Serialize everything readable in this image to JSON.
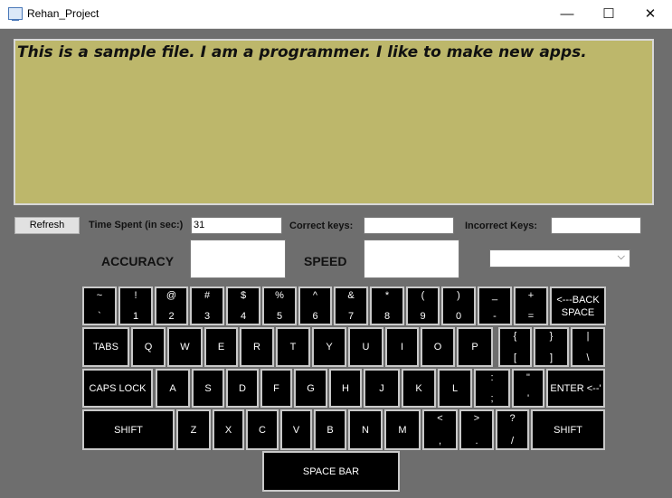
{
  "window": {
    "title": "Rehan_Project",
    "minimize": "—",
    "maximize": "☐",
    "close": "✕"
  },
  "editor": {
    "text": "This is a sample file. I am a programmer. I like to make new apps."
  },
  "stats": {
    "refresh_label": "Refresh",
    "time_label": "Time Spent (in sec:)",
    "time_value": "31",
    "correct_label": "Correct keys:",
    "correct_value": "",
    "incorrect_label": "Incorrect Keys:",
    "incorrect_value": "",
    "accuracy_label": "ACCURACY",
    "accuracy_value": "",
    "speed_label": "SPEED",
    "speed_value": "",
    "dropdown_value": ""
  },
  "keyboard": {
    "row1": [
      {
        "top": "~",
        "bottom": "`"
      },
      {
        "top": "!",
        "bottom": "1"
      },
      {
        "top": "@",
        "bottom": "2"
      },
      {
        "top": "#",
        "bottom": "3"
      },
      {
        "top": "$",
        "bottom": "4"
      },
      {
        "top": "%",
        "bottom": "5"
      },
      {
        "top": "^",
        "bottom": "6"
      },
      {
        "top": "&",
        "bottom": "7"
      },
      {
        "top": "*",
        "bottom": "8"
      },
      {
        "top": "(",
        "bottom": "9"
      },
      {
        "top": ")",
        "bottom": "0"
      },
      {
        "top": "_",
        "bottom": "-"
      },
      {
        "top": "+",
        "bottom": "="
      },
      {
        "label": "<---BACK\nSPACE"
      }
    ],
    "row2": [
      {
        "label": "TABS"
      },
      {
        "label": "Q"
      },
      {
        "label": "W"
      },
      {
        "label": "E"
      },
      {
        "label": "R"
      },
      {
        "label": "T"
      },
      {
        "label": "Y"
      },
      {
        "label": "U"
      },
      {
        "label": "I"
      },
      {
        "label": "O"
      },
      {
        "label": "P"
      },
      {
        "top": "{",
        "bottom": "["
      },
      {
        "top": "}",
        "bottom": "]"
      },
      {
        "top": "|",
        "bottom": "\\"
      }
    ],
    "row3": [
      {
        "label": "CAPS LOCK"
      },
      {
        "label": "A"
      },
      {
        "label": "S"
      },
      {
        "label": "D"
      },
      {
        "label": "F"
      },
      {
        "label": "G"
      },
      {
        "label": "H"
      },
      {
        "label": "J"
      },
      {
        "label": "K"
      },
      {
        "label": "L"
      },
      {
        "top": ":",
        "bottom": ";"
      },
      {
        "top": "\"",
        "bottom": "'"
      },
      {
        "label": "ENTER <--'"
      }
    ],
    "row4": [
      {
        "label": "SHIFT"
      },
      {
        "label": "Z"
      },
      {
        "label": "X"
      },
      {
        "label": "C"
      },
      {
        "label": "V"
      },
      {
        "label": "B"
      },
      {
        "label": "N"
      },
      {
        "label": "M"
      },
      {
        "top": "<",
        "bottom": ","
      },
      {
        "top": ">",
        "bottom": "."
      },
      {
        "top": "?",
        "bottom": "/"
      },
      {
        "label": "SHIFT"
      }
    ],
    "row5": [
      {
        "label": "SPACE BAR"
      }
    ]
  }
}
